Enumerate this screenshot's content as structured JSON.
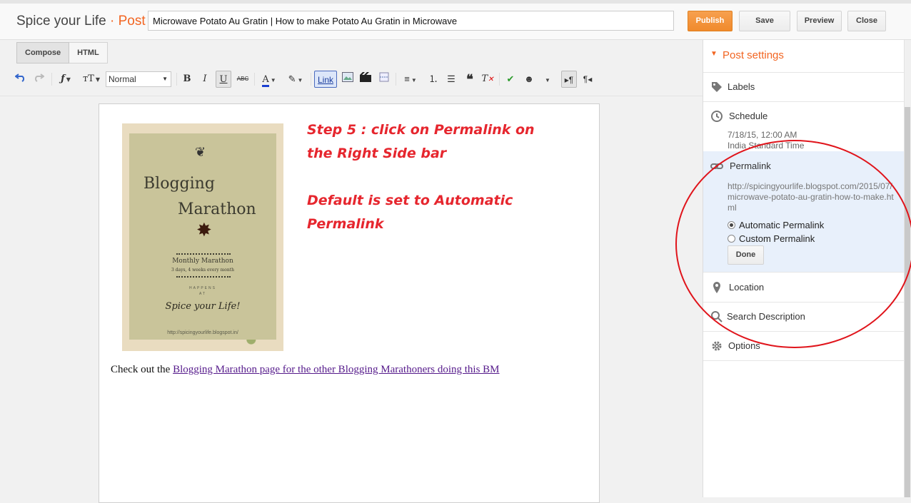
{
  "header": {
    "blog_name": "Spice your Life",
    "separator": "·",
    "section": "Post",
    "post_title": "Microwave Potato Au Gratin | How to make Potato Au Gratin in Microwave",
    "buttons": {
      "publish": "Publish",
      "save": "Save",
      "preview": "Preview",
      "close": "Close"
    },
    "accent_color": "#f26522"
  },
  "editor": {
    "modes": {
      "compose": "Compose",
      "html": "HTML",
      "active": "Compose"
    },
    "toolbar": {
      "font_style": "Normal",
      "link_label": "Link",
      "items": [
        "undo-icon",
        "redo-icon",
        "font-family-icon",
        "font-size-icon",
        "bold-icon",
        "italic-icon",
        "underline-icon",
        "strikethrough-icon",
        "text-color-icon",
        "highlight-icon",
        "link-button",
        "image-icon",
        "video-icon",
        "jump-break-icon",
        "align-icon",
        "numbered-list-icon",
        "bulleted-list-icon",
        "quote-icon",
        "clear-format-icon",
        "spellcheck-icon",
        "emoji-icon",
        "more-icon",
        "ltr-icon",
        "rtl-icon"
      ]
    }
  },
  "content": {
    "poster": {
      "title_line1": "Blogging",
      "title_line2": "Marathon",
      "subtitle": "Monthly Marathon",
      "detail": "3 days, 4 weeks every month",
      "happens": "HAPPENS",
      "at": "AT",
      "spice": "Spice your Life!",
      "url": "http://spicingyourlife.blogspot.in/"
    },
    "step_line1": "Step 5 : click on Permalink on the Right Side bar",
    "step_line2": "Default is set to Automatic Permalink",
    "checkout_prefix": "Check out the",
    "checkout_link": "Blogging Marathon page for the other Blogging Marathoners doing this BM"
  },
  "sidebar": {
    "header": "Post settings",
    "labels": "Labels",
    "schedule": "Schedule",
    "schedule_date": "7/18/15, 12:00 AM",
    "schedule_tz": "India Standard Time",
    "permalink": "Permalink",
    "permalink_url": "http://spicingyourlife.blogspot.com/2015/07/microwave-potato-au-gratin-how-to-make.html",
    "automatic_permalink": "Automatic Permalink",
    "custom_permalink": "Custom Permalink",
    "selected_permalink": "Automatic Permalink",
    "done": "Done",
    "location": "Location",
    "search_description": "Search Description",
    "options": "Options"
  }
}
